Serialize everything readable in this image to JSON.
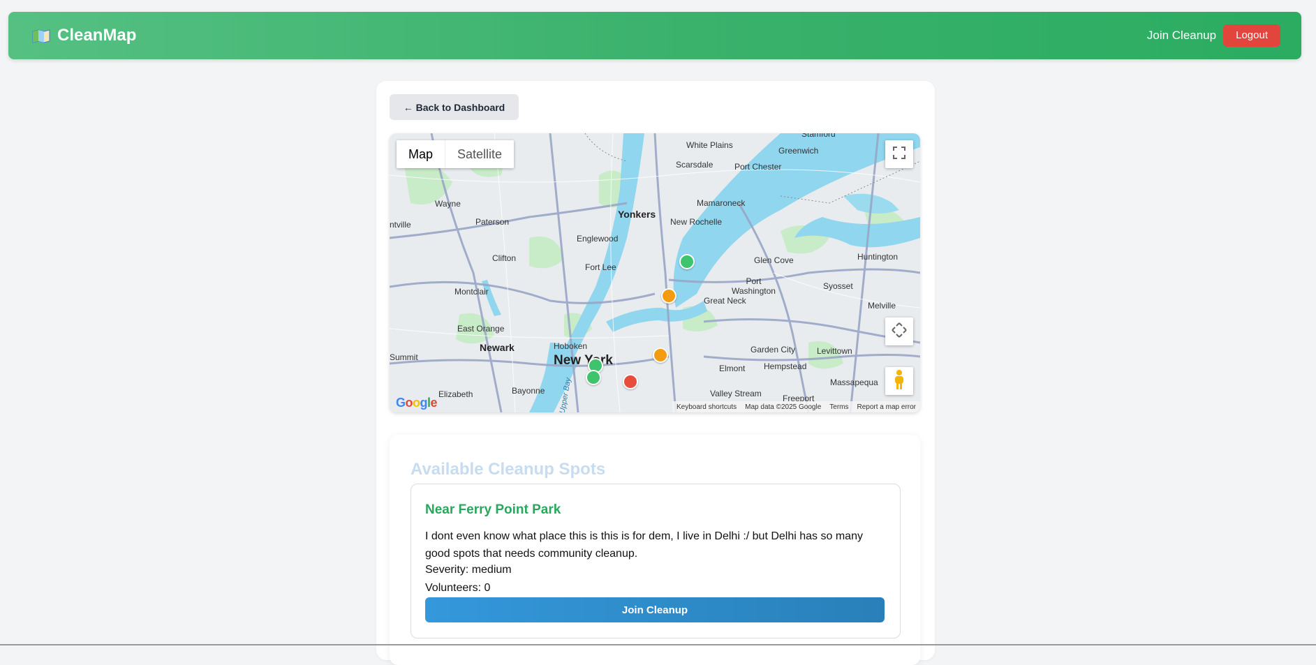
{
  "navbar": {
    "brand": "CleanMap",
    "join_link": "Join Cleanup",
    "logout_label": "Logout",
    "accent": "#2bac61"
  },
  "back_button": "← Back to Dashboard",
  "map": {
    "type_map": "Map",
    "type_satellite": "Satellite",
    "google": "Google",
    "attribution": {
      "shortcuts": "Keyboard shortcuts",
      "data": "Map data ©2025 Google",
      "terms": "Terms",
      "report": "Report a map error"
    },
    "labels": {
      "white_plains": "White Plains",
      "greenwich": "Greenwich",
      "stamford": "Stamford",
      "scarsdale": "Scarsdale",
      "port_chester": "Port Chester",
      "wayne": "Wayne",
      "mamaroneck": "Mamaroneck",
      "yonkers": "Yonkers",
      "paterson": "Paterson",
      "new_rochelle": "New Rochelle",
      "ntville": "ntville",
      "englewood": "Englewood",
      "huntington": "Huntington",
      "clifton": "Clifton",
      "glen_cove": "Glen Cove",
      "fort_lee": "Fort Lee",
      "port_washington": "Port\nWashington",
      "syosset": "Syosset",
      "montclair": "Montclair",
      "great_neck": "Great Neck",
      "melville": "Melville",
      "east_orange": "East Orange",
      "newark": "Newark",
      "hoboken": "Hoboken",
      "garden_city": "Garden City",
      "levittown": "Levittown",
      "summit": "Summit",
      "new_york": "New York",
      "elmont": "Elmont",
      "hempstead": "Hempstead",
      "elizabeth": "Elizabeth",
      "bayonne": "Bayonne",
      "massapequa": "Massapequa",
      "valley_stream": "Valley Stream",
      "freeport": "Freeport",
      "upper_bay": "Upper Bay"
    },
    "markers": [
      {
        "severity": "low",
        "color": "#3ec46d"
      },
      {
        "severity": "medium",
        "color": "#f39c12"
      },
      {
        "severity": "medium",
        "color": "#f39c12"
      },
      {
        "severity": "low",
        "color": "#3ec46d"
      },
      {
        "severity": "low",
        "color": "#3ec46d"
      },
      {
        "severity": "high",
        "color": "#e74c3c"
      }
    ]
  },
  "spots": {
    "title": "Available Cleanup Spots",
    "items": [
      {
        "name": "Near Ferry Point Park",
        "description": "I dont even know what place this is this is for dem, I live in Delhi :/ but Delhi has so many good spots that needs community cleanup.",
        "severity_text": "Severity: medium",
        "volunteers_text": "Volunteers: 0",
        "join_label": "Join Cleanup"
      }
    ]
  }
}
